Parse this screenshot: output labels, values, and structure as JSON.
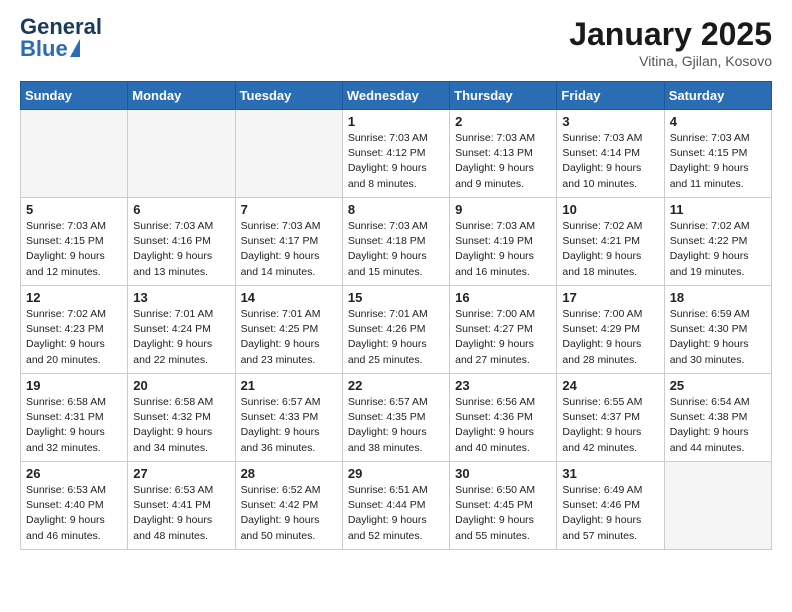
{
  "logo": {
    "general": "General",
    "blue": "Blue"
  },
  "header": {
    "month": "January 2025",
    "location": "Vitina, Gjilan, Kosovo"
  },
  "weekdays": [
    "Sunday",
    "Monday",
    "Tuesday",
    "Wednesday",
    "Thursday",
    "Friday",
    "Saturday"
  ],
  "weeks": [
    [
      {
        "day": "",
        "empty": true
      },
      {
        "day": "",
        "empty": true
      },
      {
        "day": "",
        "empty": true
      },
      {
        "day": "1",
        "sunrise": "7:03 AM",
        "sunset": "4:12 PM",
        "daylight": "9 hours and 8 minutes."
      },
      {
        "day": "2",
        "sunrise": "7:03 AM",
        "sunset": "4:13 PM",
        "daylight": "9 hours and 9 minutes."
      },
      {
        "day": "3",
        "sunrise": "7:03 AM",
        "sunset": "4:14 PM",
        "daylight": "9 hours and 10 minutes."
      },
      {
        "day": "4",
        "sunrise": "7:03 AM",
        "sunset": "4:15 PM",
        "daylight": "9 hours and 11 minutes."
      }
    ],
    [
      {
        "day": "5",
        "sunrise": "7:03 AM",
        "sunset": "4:15 PM",
        "daylight": "9 hours and 12 minutes."
      },
      {
        "day": "6",
        "sunrise": "7:03 AM",
        "sunset": "4:16 PM",
        "daylight": "9 hours and 13 minutes."
      },
      {
        "day": "7",
        "sunrise": "7:03 AM",
        "sunset": "4:17 PM",
        "daylight": "9 hours and 14 minutes."
      },
      {
        "day": "8",
        "sunrise": "7:03 AM",
        "sunset": "4:18 PM",
        "daylight": "9 hours and 15 minutes."
      },
      {
        "day": "9",
        "sunrise": "7:03 AM",
        "sunset": "4:19 PM",
        "daylight": "9 hours and 16 minutes."
      },
      {
        "day": "10",
        "sunrise": "7:02 AM",
        "sunset": "4:21 PM",
        "daylight": "9 hours and 18 minutes."
      },
      {
        "day": "11",
        "sunrise": "7:02 AM",
        "sunset": "4:22 PM",
        "daylight": "9 hours and 19 minutes."
      }
    ],
    [
      {
        "day": "12",
        "sunrise": "7:02 AM",
        "sunset": "4:23 PM",
        "daylight": "9 hours and 20 minutes."
      },
      {
        "day": "13",
        "sunrise": "7:01 AM",
        "sunset": "4:24 PM",
        "daylight": "9 hours and 22 minutes."
      },
      {
        "day": "14",
        "sunrise": "7:01 AM",
        "sunset": "4:25 PM",
        "daylight": "9 hours and 23 minutes."
      },
      {
        "day": "15",
        "sunrise": "7:01 AM",
        "sunset": "4:26 PM",
        "daylight": "9 hours and 25 minutes."
      },
      {
        "day": "16",
        "sunrise": "7:00 AM",
        "sunset": "4:27 PM",
        "daylight": "9 hours and 27 minutes."
      },
      {
        "day": "17",
        "sunrise": "7:00 AM",
        "sunset": "4:29 PM",
        "daylight": "9 hours and 28 minutes."
      },
      {
        "day": "18",
        "sunrise": "6:59 AM",
        "sunset": "4:30 PM",
        "daylight": "9 hours and 30 minutes."
      }
    ],
    [
      {
        "day": "19",
        "sunrise": "6:58 AM",
        "sunset": "4:31 PM",
        "daylight": "9 hours and 32 minutes."
      },
      {
        "day": "20",
        "sunrise": "6:58 AM",
        "sunset": "4:32 PM",
        "daylight": "9 hours and 34 minutes."
      },
      {
        "day": "21",
        "sunrise": "6:57 AM",
        "sunset": "4:33 PM",
        "daylight": "9 hours and 36 minutes."
      },
      {
        "day": "22",
        "sunrise": "6:57 AM",
        "sunset": "4:35 PM",
        "daylight": "9 hours and 38 minutes."
      },
      {
        "day": "23",
        "sunrise": "6:56 AM",
        "sunset": "4:36 PM",
        "daylight": "9 hours and 40 minutes."
      },
      {
        "day": "24",
        "sunrise": "6:55 AM",
        "sunset": "4:37 PM",
        "daylight": "9 hours and 42 minutes."
      },
      {
        "day": "25",
        "sunrise": "6:54 AM",
        "sunset": "4:38 PM",
        "daylight": "9 hours and 44 minutes."
      }
    ],
    [
      {
        "day": "26",
        "sunrise": "6:53 AM",
        "sunset": "4:40 PM",
        "daylight": "9 hours and 46 minutes."
      },
      {
        "day": "27",
        "sunrise": "6:53 AM",
        "sunset": "4:41 PM",
        "daylight": "9 hours and 48 minutes."
      },
      {
        "day": "28",
        "sunrise": "6:52 AM",
        "sunset": "4:42 PM",
        "daylight": "9 hours and 50 minutes."
      },
      {
        "day": "29",
        "sunrise": "6:51 AM",
        "sunset": "4:44 PM",
        "daylight": "9 hours and 52 minutes."
      },
      {
        "day": "30",
        "sunrise": "6:50 AM",
        "sunset": "4:45 PM",
        "daylight": "9 hours and 55 minutes."
      },
      {
        "day": "31",
        "sunrise": "6:49 AM",
        "sunset": "4:46 PM",
        "daylight": "9 hours and 57 minutes."
      },
      {
        "day": "",
        "empty": true
      }
    ]
  ]
}
